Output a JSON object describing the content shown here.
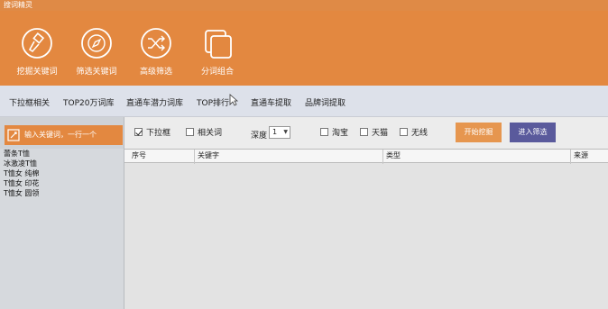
{
  "window": {
    "title": "搜词精灵"
  },
  "ribbon": {
    "items": [
      {
        "label": "挖掘关键词",
        "icon": "flashlight-icon"
      },
      {
        "label": "筛选关键词",
        "icon": "compass-icon"
      },
      {
        "label": "高级筛选",
        "icon": "shuffle-icon"
      },
      {
        "label": "分词组合",
        "icon": "copy-icon"
      }
    ]
  },
  "nav": {
    "tabs": [
      {
        "label": "下拉框相关"
      },
      {
        "label": "TOP20万词库"
      },
      {
        "label": "直通车潜力词库"
      },
      {
        "label": "TOP排行"
      },
      {
        "label": "直通车提取"
      },
      {
        "label": "品牌词提取"
      }
    ]
  },
  "sidebar": {
    "input_button_label": "输入关键词，一行一个",
    "keywords": [
      "蕾条T恤",
      "冰激凌T恤",
      "T恤女 纯棉",
      "T恤女 印花",
      "T恤女 圆领"
    ]
  },
  "options": {
    "dropdown_label": "下拉框",
    "related_label": "相关词",
    "depth_label": "深度",
    "depth_value": "1",
    "taobao_label": "淘宝",
    "tmall_label": "天猫",
    "wireless_label": "无线",
    "start_button": "开始挖掘",
    "filter_button": "进入筛选"
  },
  "grid": {
    "columns": [
      "序号",
      "关键字",
      "类型",
      "来源"
    ]
  },
  "colors": {
    "accent": "#E38840",
    "purple": "#5A5A9C"
  }
}
